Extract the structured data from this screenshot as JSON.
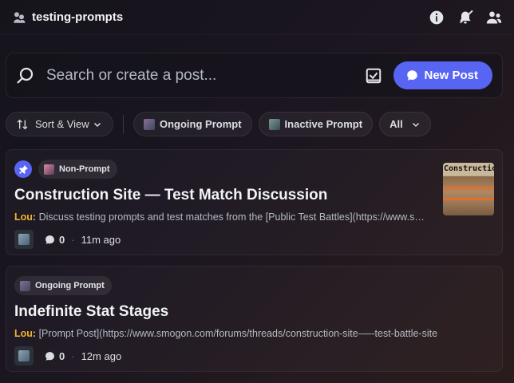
{
  "header": {
    "channel_name": "testing-prompts",
    "icons": [
      "forum-icon",
      "info-icon",
      "notifications-off-icon",
      "members-icon"
    ]
  },
  "search": {
    "placeholder": "Search or create a post...",
    "new_post_label": "New Post"
  },
  "filters": {
    "sort_label": "Sort & View",
    "tags": [
      "Ongoing Prompt",
      "Inactive Prompt"
    ],
    "all_label": "All"
  },
  "posts": [
    {
      "pinned": true,
      "tag": "Non-Prompt",
      "title": "Construction Site — Test Match Discussion",
      "author": "Lou:",
      "preview": "Discuss testing prompts and test matches from the [Public Test Battles](https://www.smogon.com/forums/threads/construction-site",
      "message_count": "0",
      "time": "11m ago",
      "thumbnail_text": "Construction"
    },
    {
      "pinned": false,
      "tag": "Ongoing Prompt",
      "title": "Indefinite Stat Stages",
      "author": "Lou:",
      "preview": "[Prompt Post](https://www.smogon.com/forums/threads/construction-site-—-test-battle-site",
      "message_count": "0",
      "time": "12m ago"
    }
  ],
  "colors": {
    "accent": "#5865f2",
    "author": "#f0b232"
  }
}
